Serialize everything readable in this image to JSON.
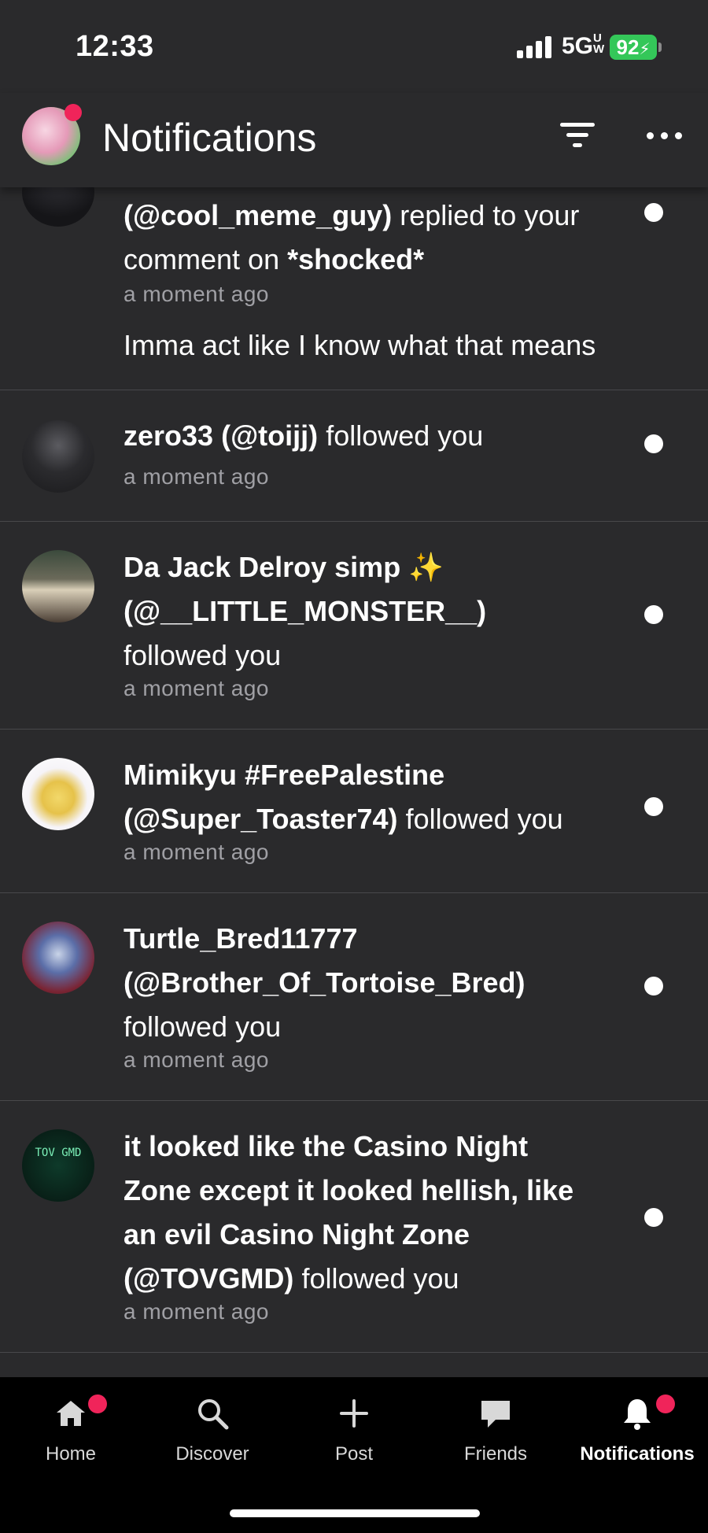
{
  "status_bar": {
    "time": "12:33",
    "network": "5G",
    "network_sup": "UW",
    "battery": "92"
  },
  "header": {
    "title": "Notifications"
  },
  "notifications": [
    {
      "name_handle": "(@cool_meme_guy)",
      "action": "replied to your comment on",
      "target": "*shocked*",
      "time": "a moment ago",
      "reply": "Imma act like I know what that means"
    },
    {
      "name": "zero33",
      "handle": "(@toijj)",
      "action": "followed you",
      "time": "a moment ago"
    },
    {
      "name": "Da Jack Delroy simp ✨",
      "handle": "(@__LITTLE_MONSTER__)",
      "action": "followed you",
      "time": "a moment ago"
    },
    {
      "name": "Mimikyu #FreePalestine",
      "handle": "(@Super_Toaster74)",
      "action": "followed you",
      "time": "a moment ago"
    },
    {
      "name": "Turtle_Bred11777",
      "handle": "(@Brother_Of_Tortoise_Bred)",
      "action": "followed you",
      "time": "a moment ago"
    },
    {
      "name_lines": [
        "it looked like the Casino Night",
        "Zone except it looked hellish, like",
        "an evil Casino Night Zone"
      ],
      "handle": "(@TOVGMD)",
      "action": "followed you",
      "time": "a moment ago",
      "avatar_text": "TOV GMD"
    }
  ],
  "tabs": [
    {
      "label": "Home",
      "icon": "home-icon",
      "badge": true
    },
    {
      "label": "Discover",
      "icon": "search-icon",
      "badge": false
    },
    {
      "label": "Post",
      "icon": "plus-icon",
      "badge": false
    },
    {
      "label": "Friends",
      "icon": "chat-bubble-icon",
      "badge": false
    },
    {
      "label": "Notifications",
      "icon": "bell-icon",
      "badge": true,
      "active": true
    }
  ],
  "colors": {
    "background": "#2a2a2c",
    "badge": "#f0245a",
    "battery": "#34c759",
    "muted": "#a0a0a5"
  }
}
